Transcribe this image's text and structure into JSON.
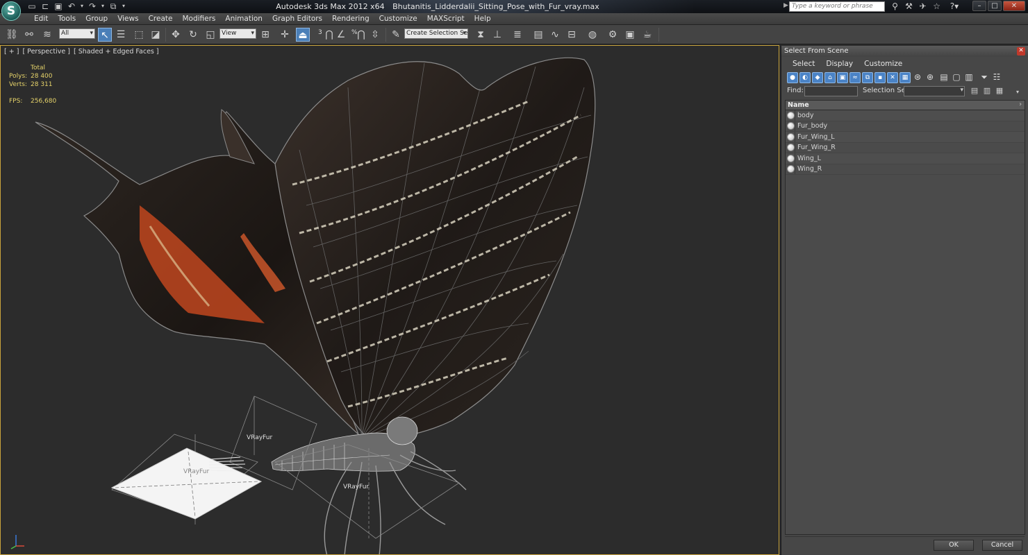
{
  "titlebar": {
    "app_name": "Autodesk 3ds Max  2012 x64",
    "file_name": "Bhutanitis_Lidderdalii_Sitting_Pose_with_Fur_vray.max",
    "logo_letter": "S",
    "search_placeholder": "Type a keyword or phrase"
  },
  "menu": {
    "items": [
      "Edit",
      "Tools",
      "Group",
      "Views",
      "Create",
      "Modifiers",
      "Animation",
      "Graph Editors",
      "Rendering",
      "Customize",
      "MAXScript",
      "Help"
    ]
  },
  "toolbar": {
    "selection_filter": "All",
    "reference_coord": "View",
    "snap_3d": "3",
    "percent_snap": "%",
    "named_selection": "Create Selection Se"
  },
  "viewport": {
    "label_plus": "[ + ]",
    "label_view": "[ Perspective ]",
    "label_shading": "[ Shaded + Edged Faces ]",
    "stats": {
      "header": "Total",
      "polys_label": "Polys:",
      "polys_value": "28 400",
      "verts_label": "Verts:",
      "verts_value": "28 311",
      "fps_label": "FPS:",
      "fps_value": "256,680"
    },
    "helper_labels": [
      "VRayFur",
      "VRayFur",
      "VRayFur"
    ],
    "axis": {
      "x": "x",
      "y": "y",
      "z": "z"
    }
  },
  "dialog": {
    "title": "Select From Scene",
    "menu": [
      "Select",
      "Display",
      "Customize"
    ],
    "find_label": "Find:",
    "selection_set_label": "Selection Set:",
    "list_header": "Name",
    "objects": [
      "body",
      "Fur_body",
      "Fur_Wing_L",
      "Fur_Wing_R",
      "Wing_L",
      "Wing_R"
    ],
    "ok_label": "OK",
    "cancel_label": "Cancel"
  }
}
